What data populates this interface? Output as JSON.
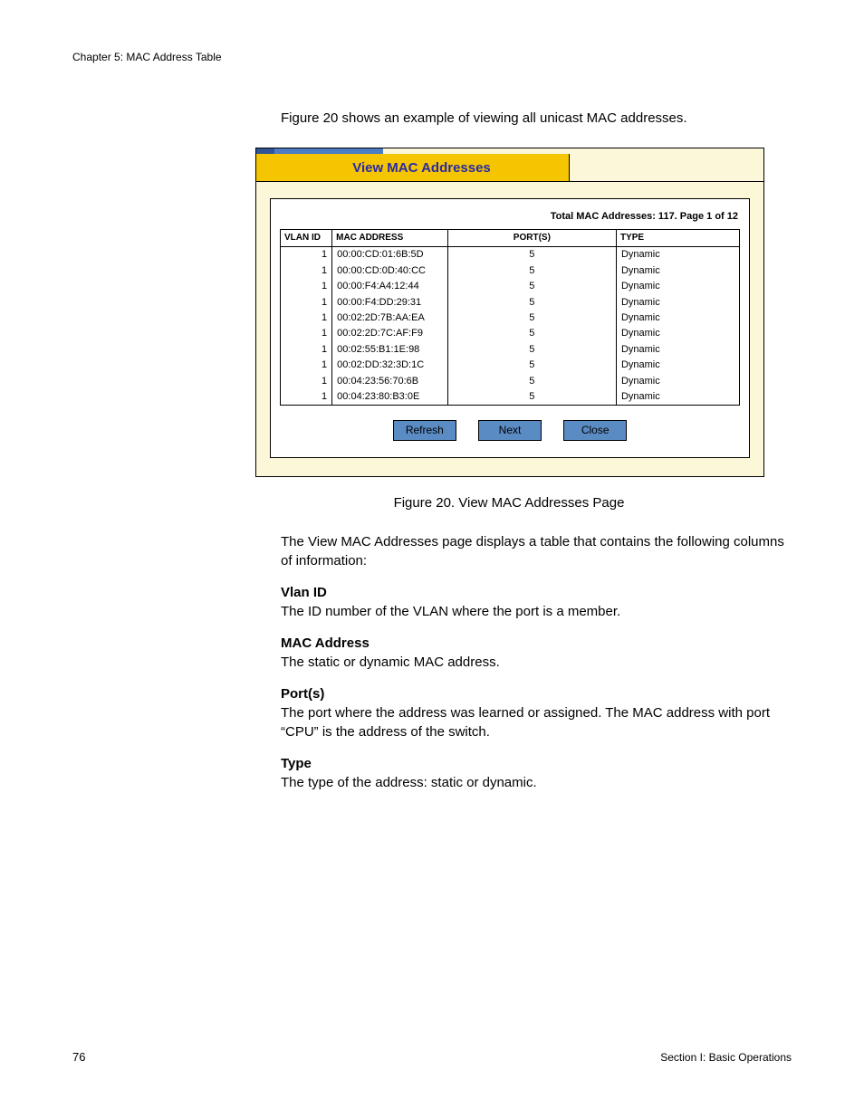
{
  "chapter": "Chapter 5: MAC Address Table",
  "intro": "Figure 20 shows an example of viewing all unicast MAC addresses.",
  "panel": {
    "title": "View MAC Addresses",
    "summary": "Total MAC Addresses: 117. Page 1 of 12",
    "headers": {
      "vlan": "VLAN ID",
      "mac": "MAC ADDRESS",
      "port": "PORT(S)",
      "type": "TYPE"
    },
    "rows": [
      {
        "vlan": "1",
        "mac": "00:00:CD:01:6B:5D",
        "port": "5",
        "type": "Dynamic"
      },
      {
        "vlan": "1",
        "mac": "00:00:CD:0D:40:CC",
        "port": "5",
        "type": "Dynamic"
      },
      {
        "vlan": "1",
        "mac": "00:00:F4:A4:12:44",
        "port": "5",
        "type": "Dynamic"
      },
      {
        "vlan": "1",
        "mac": "00:00:F4:DD:29:31",
        "port": "5",
        "type": "Dynamic"
      },
      {
        "vlan": "1",
        "mac": "00:02:2D:7B:AA:EA",
        "port": "5",
        "type": "Dynamic"
      },
      {
        "vlan": "1",
        "mac": "00:02:2D:7C:AF:F9",
        "port": "5",
        "type": "Dynamic"
      },
      {
        "vlan": "1",
        "mac": "00:02:55:B1:1E:98",
        "port": "5",
        "type": "Dynamic"
      },
      {
        "vlan": "1",
        "mac": "00:02:DD:32:3D:1C",
        "port": "5",
        "type": "Dynamic"
      },
      {
        "vlan": "1",
        "mac": "00:04:23:56:70:6B",
        "port": "5",
        "type": "Dynamic"
      },
      {
        "vlan": "1",
        "mac": "00:04:23:80:B3:0E",
        "port": "5",
        "type": "Dynamic"
      }
    ],
    "buttons": {
      "refresh": "Refresh",
      "next": "Next",
      "close": "Close"
    }
  },
  "caption": "Figure 20. View MAC Addresses Page",
  "body": {
    "lead": "The View MAC Addresses page displays a table that contains the following columns of information:",
    "defs": [
      {
        "term": "Vlan ID",
        "def": "The ID number of the VLAN where the port is a member."
      },
      {
        "term": "MAC Address",
        "def": "The static or dynamic MAC address."
      },
      {
        "term": "Port(s)",
        "def": "The port where the address was learned or assigned. The MAC address with port “CPU” is the address of the switch."
      },
      {
        "term": "Type",
        "def": "The type of the address: static or dynamic."
      }
    ]
  },
  "page_number": "76",
  "section_footer": "Section I: Basic Operations"
}
